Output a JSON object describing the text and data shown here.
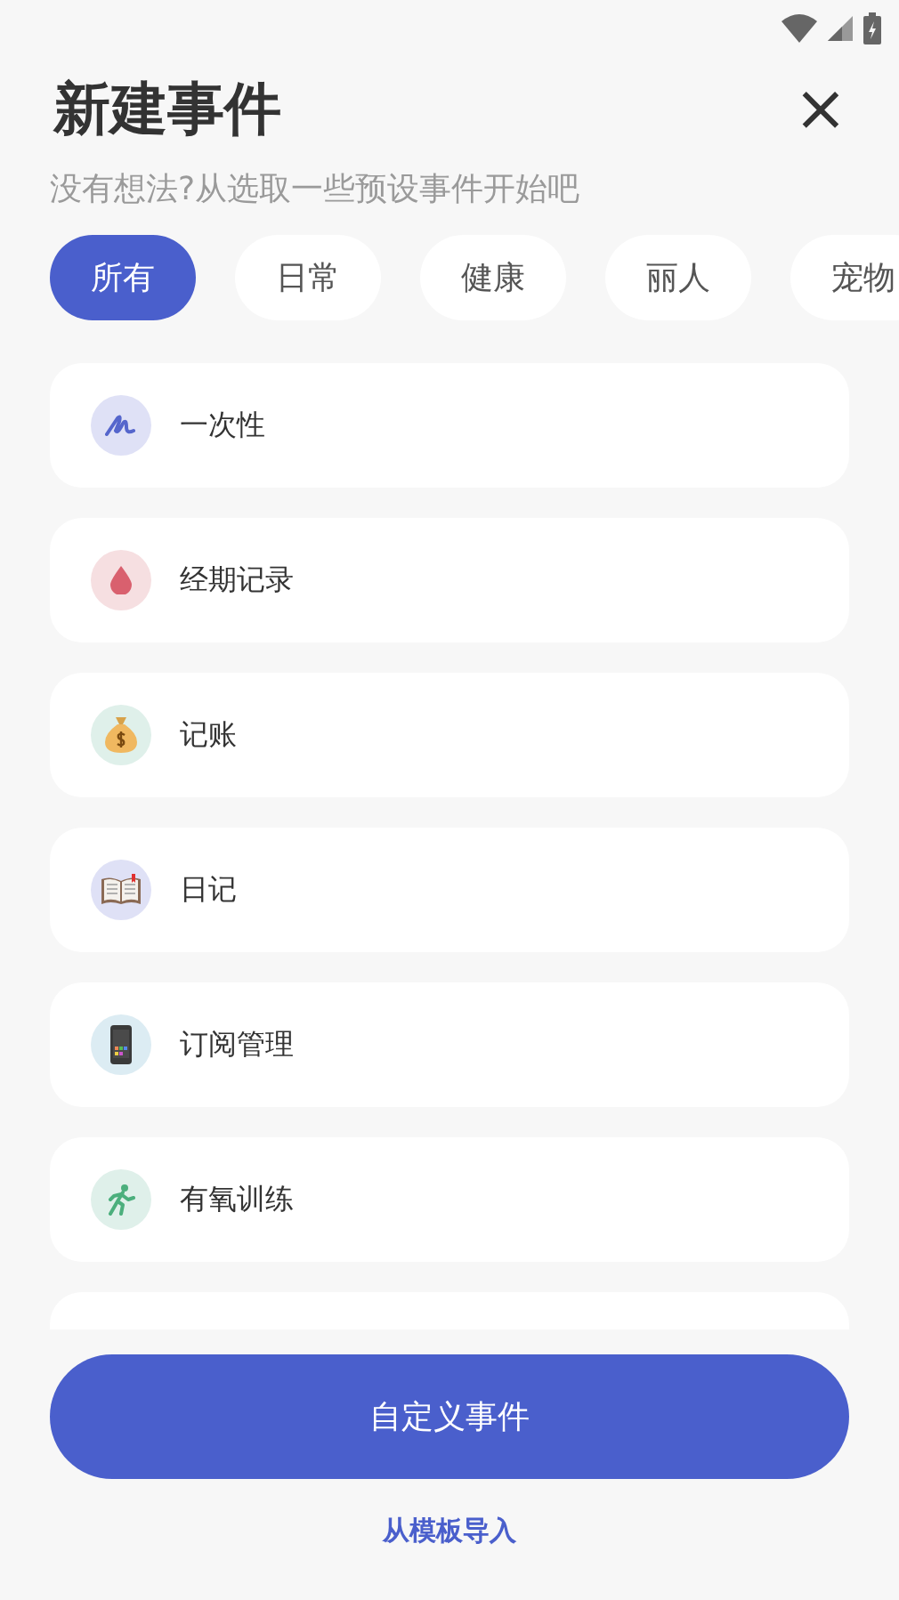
{
  "title": "新建事件",
  "subtitle": "没有想法?从选取一些预设事件开始吧",
  "close": "×",
  "tabs": [
    {
      "label": "所有",
      "selected": true
    },
    {
      "label": "日常",
      "selected": false
    },
    {
      "label": "健康",
      "selected": false
    },
    {
      "label": "丽人",
      "selected": false
    },
    {
      "label": "宠物",
      "selected": false
    }
  ],
  "events": [
    {
      "label": "一次性",
      "kind": "scribble",
      "color": "#dfe1f6"
    },
    {
      "label": "经期记录",
      "kind": "drop",
      "color": "#f6dfe1"
    },
    {
      "label": "记账",
      "kind": "moneybag",
      "color": "#dff0ea"
    },
    {
      "label": "日记",
      "kind": "book",
      "color": "#dfe1f6"
    },
    {
      "label": "订阅管理",
      "kind": "phone",
      "color": "#dcecf3"
    },
    {
      "label": "有氧训练",
      "kind": "runner",
      "color": "#dff0ea"
    }
  ],
  "primary_button": "自定义事件",
  "link": "从模板导入"
}
